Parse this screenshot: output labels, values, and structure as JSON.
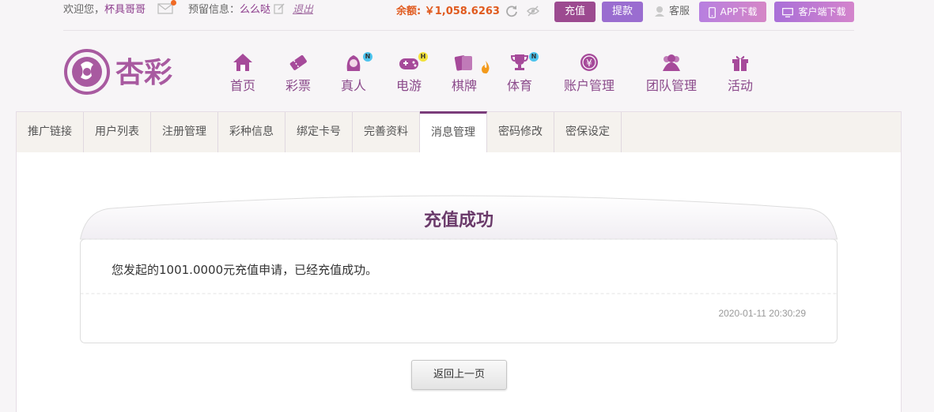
{
  "topbar": {
    "welcome_prefix": "欢迎您，",
    "username": "杯具哥哥",
    "reserve_label": "预留信息：",
    "reserve_value": "么么哒",
    "logout": "退出",
    "balance": "余额: ￥1,058.6263",
    "recharge_label": "充值",
    "withdraw_label": "提款",
    "service_label": "客服",
    "app_download_label": "APP下载",
    "client_download_label": "客户端下载"
  },
  "logo": {
    "text": "杏彩"
  },
  "nav": {
    "items": [
      {
        "label": "首页",
        "icon": "home-icon"
      },
      {
        "label": "彩票",
        "icon": "ticket-icon"
      },
      {
        "label": "真人",
        "icon": "live-dealer-icon",
        "badge": "N"
      },
      {
        "label": "电游",
        "icon": "gamepad-icon",
        "badge": "H"
      },
      {
        "label": "棋牌",
        "icon": "cards-icon"
      },
      {
        "label": "体育",
        "icon": "trophy-icon",
        "badge": "N"
      },
      {
        "label": "账户管理",
        "icon": "yen-coin-icon"
      },
      {
        "label": "团队管理",
        "icon": "team-icon"
      },
      {
        "label": "活动",
        "icon": "gift-icon"
      }
    ]
  },
  "tabs": [
    {
      "label": "推广链接"
    },
    {
      "label": "用户列表"
    },
    {
      "label": "注册管理"
    },
    {
      "label": "彩种信息"
    },
    {
      "label": "绑定卡号"
    },
    {
      "label": "完善资料"
    },
    {
      "label": "消息管理",
      "active": true
    },
    {
      "label": "密码修改"
    },
    {
      "label": "密保设定"
    }
  ],
  "message": {
    "title": "充值成功",
    "body": "您发起的1001.0000元充值申请，已经充值成功。",
    "time": "2020-01-11 20:30:29",
    "back_label": "返回上一页"
  },
  "colors": {
    "brand": "#8b3a8b",
    "balance": "#e05a1e",
    "recharge_btn": "#9c4a90",
    "withdraw_btn": "#9a6dd0",
    "active_tab": "#7b3d7b"
  }
}
